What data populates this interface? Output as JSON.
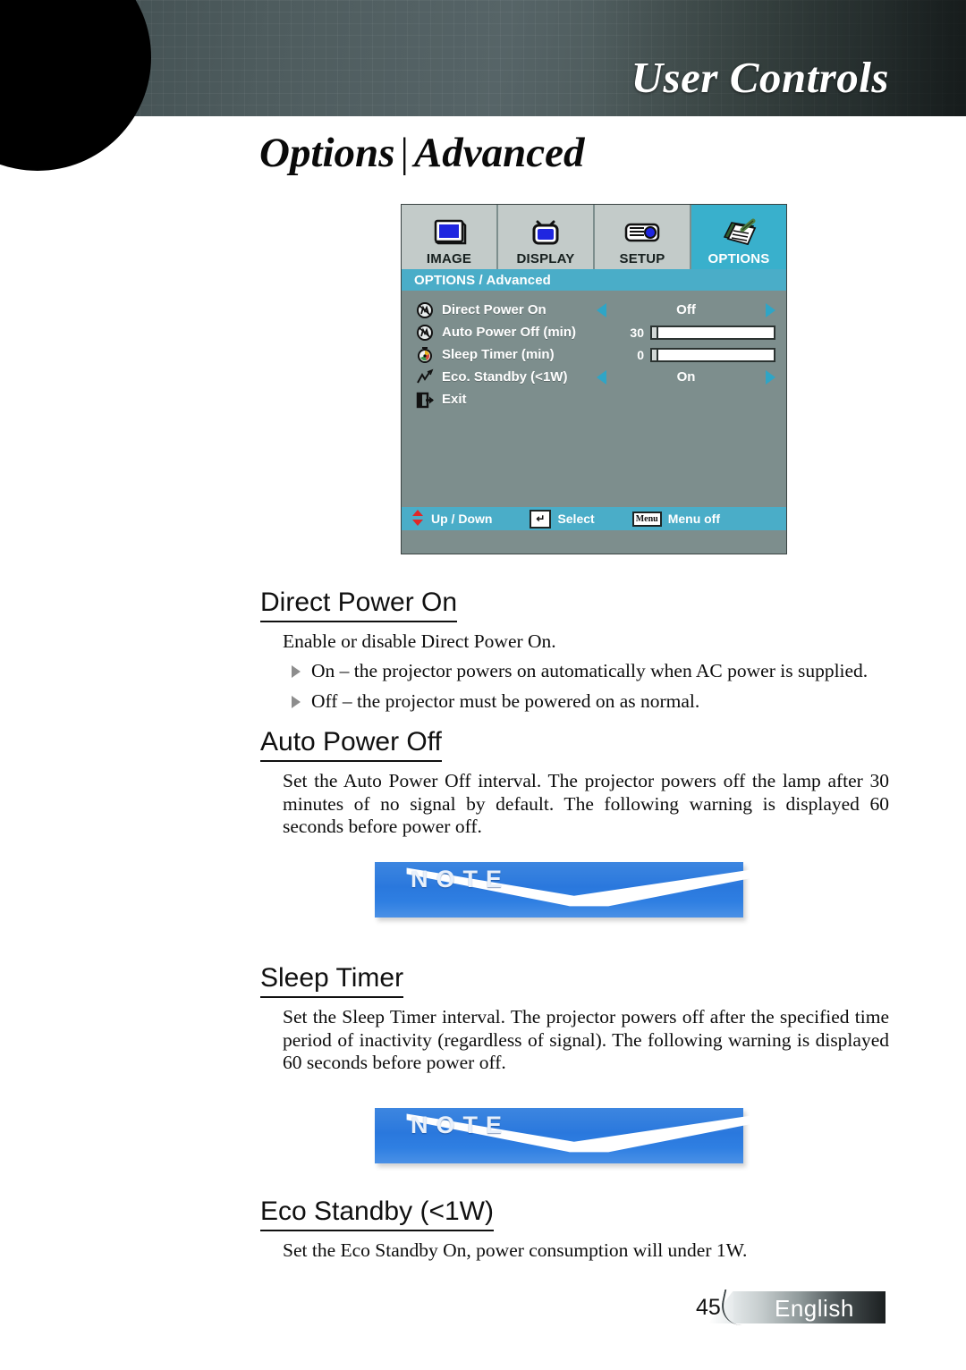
{
  "header": {
    "title": "User Controls",
    "lens_icon": "camera-lens-graphic"
  },
  "page_title": {
    "primary": "Options",
    "separator": "|",
    "secondary": "Advanced"
  },
  "osd": {
    "tabs": [
      {
        "label": "IMAGE",
        "icon": "monitor-icon",
        "active": false
      },
      {
        "label": "DISPLAY",
        "icon": "tv-icon",
        "active": false
      },
      {
        "label": "SETUP",
        "icon": "projector-icon",
        "active": false
      },
      {
        "label": "OPTIONS",
        "icon": "clipboard-pen-icon",
        "active": true
      }
    ],
    "subtitle": "OPTIONS / Advanced",
    "rows": [
      {
        "label": "Direct Power On",
        "icon": "power-circle-icon",
        "type": "choice",
        "value": "Off"
      },
      {
        "label": "Auto Power Off (min)",
        "icon": "power-circle-icon",
        "type": "slider",
        "value": "30",
        "fill_pct": 4
      },
      {
        "label": "Sleep Timer (min)",
        "icon": "timer-icon",
        "type": "slider",
        "value": "0",
        "fill_pct": 0
      },
      {
        "label": "Eco. Standby (<1W)",
        "icon": "chart-zigzag-icon",
        "type": "choice",
        "value": "On"
      },
      {
        "label": "Exit",
        "icon": "exit-door-icon",
        "type": "action",
        "value": ""
      }
    ],
    "footer": [
      {
        "key_icon": "up-down-arrows-icon",
        "label": "Up / Down"
      },
      {
        "key_icon": "enter-key-icon",
        "label": "Select"
      },
      {
        "key_icon": "menu-key-icon",
        "key_text": "Menu",
        "label": "Menu off"
      }
    ],
    "colors": {
      "accent": "#4aadc8",
      "active_tab": "#39b0cc",
      "panel": "#7d8e8d",
      "tab_bg": "#c3cbc9"
    }
  },
  "sections": [
    {
      "heading": "Direct Power On",
      "intro": "Enable or disable Direct Power On.",
      "bullets": [
        "On – the projector powers on automatically when AC power is supplied.",
        "Off –  the projector must be powered on as normal."
      ]
    },
    {
      "heading": "Auto Power Off",
      "body": "Set the Auto Power Off interval. The projector powers off the lamp after 30 minutes of no signal by default. The following warning is displayed 60 seconds before power off."
    },
    {
      "heading": "Sleep Timer",
      "body": "Set the Sleep Timer interval. The projector powers off after the specified time period of inactivity (regardless of signal). The following warning is displayed 60 seconds before power off."
    },
    {
      "heading": "Eco Standby (<1W)",
      "body": "Set the Eco Standby On, power consumption will under 1W."
    }
  ],
  "notes": [
    {
      "label": "NOTE"
    },
    {
      "label": "NOTE"
    }
  ],
  "footer": {
    "page_number": "45",
    "language": "English"
  }
}
